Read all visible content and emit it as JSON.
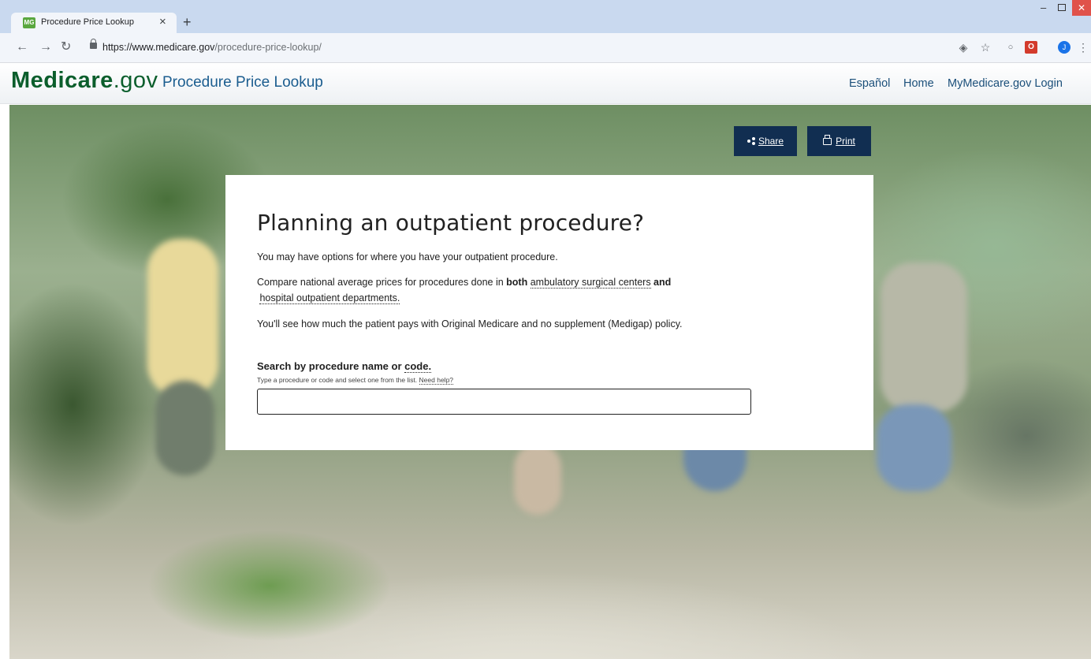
{
  "browser": {
    "tab_title": "Procedure Price Lookup",
    "favicon_text": "MG",
    "url_host": "https://www.medicare.gov",
    "url_path": "/procedure-price-lookup/",
    "profile_initial": "J",
    "ext_red_text": "O"
  },
  "header": {
    "logo_main": "Medicare",
    "logo_domain": ".gov",
    "subtitle": "Procedure Price Lookup",
    "links": [
      "Español",
      "Home",
      "MyMedicare.gov Login"
    ]
  },
  "actions": {
    "share_label": "Share",
    "print_label": "Print"
  },
  "card": {
    "title": "Planning an outpatient procedure?",
    "para1": "You may have options for where you have your outpatient procedure.",
    "para2_a": "Compare national average prices for procedures done in ",
    "para2_b": "both",
    "para2_c": " ",
    "para2_link1": "ambulatory surgical centers",
    "para2_d": " and",
    "para2_link2": "hospital outpatient departments.",
    "para3": "You'll see how much the patient pays with Original Medicare and no supplement (Medigap) policy.",
    "search_label_a": "Search by procedure name or ",
    "search_label_link": "code.",
    "search_help_a": "Type a procedure or code and select one from the list. ",
    "search_help_link": "Need help?",
    "search_value": ""
  },
  "colors": {
    "navy": "#112e51",
    "logo_green": "#0b5e2c",
    "subtitle_blue": "#1b5d8f"
  }
}
